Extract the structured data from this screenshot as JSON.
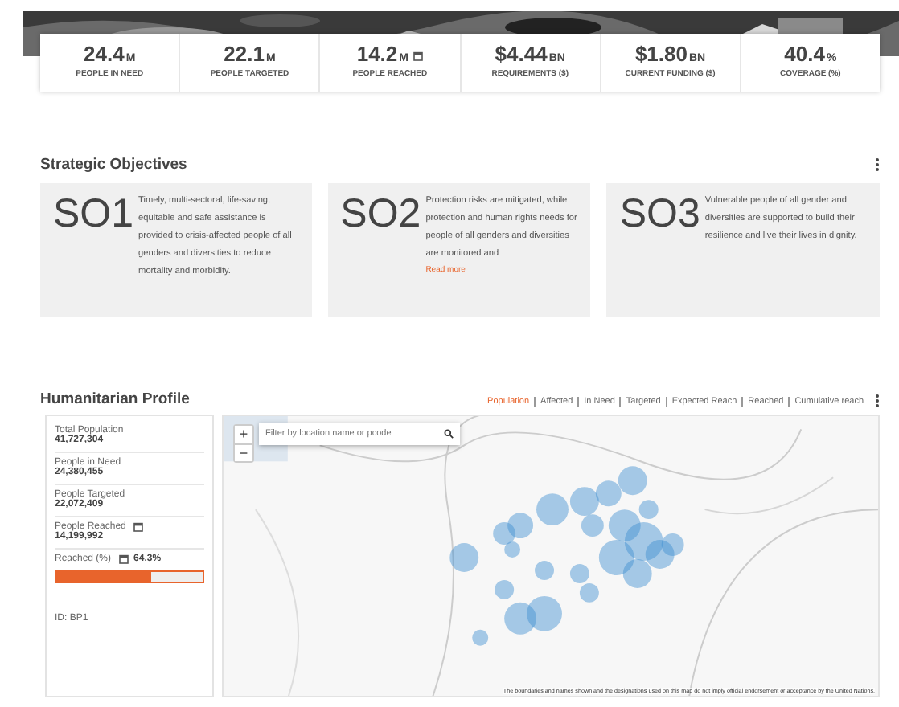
{
  "stats": [
    {
      "value": "24.4",
      "unit": "M",
      "label": "PEOPLE IN NEED",
      "calendar": false
    },
    {
      "value": "22.1",
      "unit": "M",
      "label": "PEOPLE TARGETED",
      "calendar": false
    },
    {
      "value": "14.2",
      "unit": "M",
      "label": "PEOPLE REACHED",
      "calendar": true
    },
    {
      "value": "$4.44",
      "unit": "BN",
      "label": "REQUIREMENTS ($)",
      "calendar": false
    },
    {
      "value": "$1.80",
      "unit": "BN",
      "label": "CURRENT FUNDING ($)",
      "calendar": false
    },
    {
      "value": "40.4",
      "unit": "%",
      "label": "COVERAGE (%)",
      "calendar": false
    }
  ],
  "objectives": {
    "title": "Strategic Objectives",
    "cards": [
      {
        "code": "SO1",
        "text": "Timely, multi-sectoral, life-saving, equitable and safe assistance is provided to crisis-affected people of all genders and diversities to reduce mortality and morbidity."
      },
      {
        "code": "SO2",
        "text": "Protection risks are mitigated, while protection and human rights needs for people of all genders and diversities are monitored and",
        "link": "Read more"
      },
      {
        "code": "SO3",
        "text": "Vulnerable people of all gender and diversities are supported to build their resilience and live their lives in dignity."
      }
    ]
  },
  "profile": {
    "title": "Humanitarian Profile",
    "tabs": [
      {
        "label": "Population",
        "selected": true
      },
      {
        "label": "Affected",
        "selected": false
      },
      {
        "label": "In Need",
        "selected": false
      },
      {
        "label": "Targeted",
        "selected": false
      },
      {
        "label": "Expected Reach",
        "selected": false
      },
      {
        "label": "Reached",
        "selected": false
      },
      {
        "label": "Cumulative reach",
        "selected": false
      }
    ],
    "figures": [
      {
        "kind": "number",
        "label": "Total Population",
        "value": "41,727,304",
        "calendar": false
      },
      {
        "kind": "number",
        "label": "People in Need",
        "value": "24,380,455",
        "calendar": false
      },
      {
        "kind": "number",
        "label": "People Targeted",
        "value": "22,072,409",
        "calendar": false
      },
      {
        "kind": "number",
        "label": "People Reached",
        "value": "14,199,992",
        "calendar": true
      },
      {
        "kind": "progress",
        "label": "Reached (%)",
        "value": "64.3%",
        "calendar": true,
        "level": 0.643
      }
    ],
    "id": "ID: BP1",
    "map": {
      "kind": "picture",
      "zoom_in": "+",
      "zoom_out": "−",
      "search": {
        "placeholder": "Filter by location name or pcode"
      },
      "disclaimer": "The boundaries and names shown and the designations used on this map do not imply official endorsement or acceptance by the United Nations."
    }
  }
}
